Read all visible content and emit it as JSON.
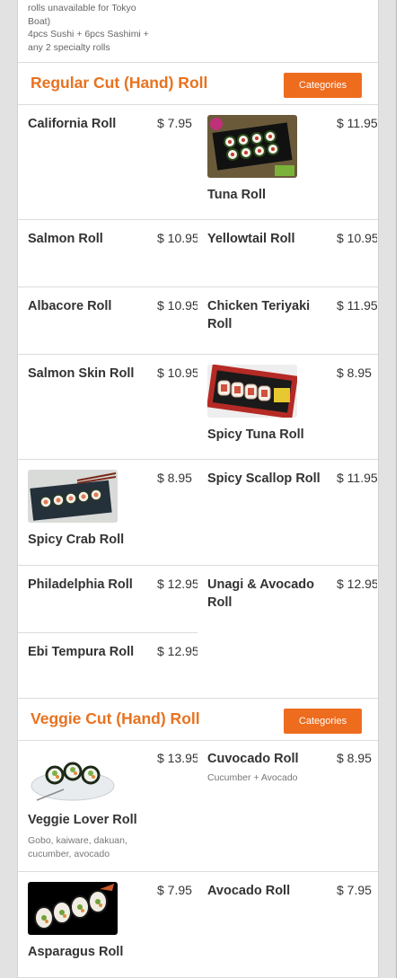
{
  "intro": {
    "lines": [
      "rolls unavailable for Tokyo",
      "Boat)",
      "4pcs Sushi + 6pcs Sashimi +",
      "any 2 specialty rolls"
    ]
  },
  "sections": [
    {
      "title": "Regular Cut (Hand) Roll",
      "button": "Categories",
      "items": [
        {
          "name": "California Roll",
          "price": "$ 7.95"
        },
        {
          "name": "Tuna Roll",
          "price": "$ 11.95",
          "image": "tuna-roll-photo"
        },
        {
          "name": "Salmon Roll",
          "price": "$ 10.95"
        },
        {
          "name": "Yellowtail Roll",
          "price": "$ 10.95"
        },
        {
          "name": "Albacore Roll",
          "price": "$ 10.95"
        },
        {
          "name": "Chicken Teriyaki Roll",
          "price": "$ 11.95"
        },
        {
          "name": "Salmon Skin Roll",
          "price": "$ 10.95"
        },
        {
          "name": "Spicy Tuna Roll",
          "price": "$ 8.95",
          "image": "spicy-tuna-roll-photo"
        },
        {
          "name": "Spicy Crab Roll",
          "price": "$ 8.95",
          "image": "spicy-crab-roll-photo"
        },
        {
          "name": "Spicy Scallop Roll",
          "price": "$ 11.95"
        },
        {
          "name": "Philadelphia Roll",
          "price": "$ 12.95"
        },
        {
          "name": "Unagi & Avocado Roll",
          "price": "$ 12.95"
        },
        {
          "name": "Ebi Tempura Roll",
          "price": "$ 12.95"
        }
      ]
    },
    {
      "title": "Veggie Cut (Hand) Roll",
      "button": "Categories",
      "items": [
        {
          "name": "Veggie Lover Roll",
          "price": "$ 13.95",
          "desc": "Gobo, kaiware, dakuan, cucumber, avocado",
          "image": "veggie-lover-roll-photo"
        },
        {
          "name": "Cuvocado Roll",
          "price": "$ 8.95",
          "desc": "Cucumber + Avocado"
        },
        {
          "name": "Asparagus Roll",
          "price": "$ 7.95",
          "image": "asparagus-roll-photo"
        },
        {
          "name": "Avocado Roll",
          "price": "$ 7.95"
        }
      ]
    }
  ],
  "colors": {
    "accent": "#e8721f",
    "button": "#ee6c1e"
  }
}
